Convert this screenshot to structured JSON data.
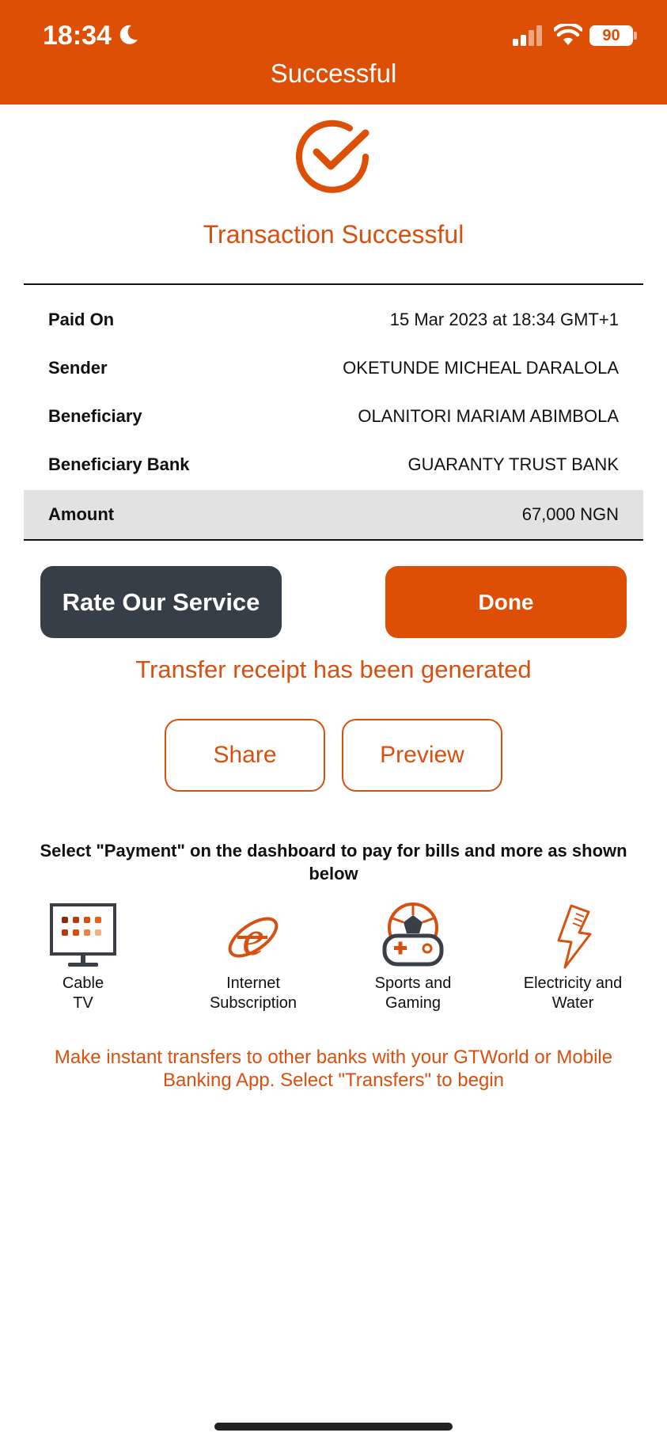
{
  "status_bar": {
    "time": "18:34",
    "battery": "90",
    "icons": [
      "moon-icon",
      "signal-icon",
      "wifi-icon",
      "battery-icon"
    ]
  },
  "header": {
    "title": "Successful"
  },
  "result": {
    "icon": "check-circle-icon",
    "title": "Transaction Successful"
  },
  "details": [
    {
      "label": "Paid On",
      "value": "15 Mar 2023 at 18:34 GMT+1"
    },
    {
      "label": "Sender",
      "value": "OKETUNDE MICHEAL DARALOLA"
    },
    {
      "label": "Beneficiary",
      "value": "OLANITORI MARIAM ABIMBOLA"
    },
    {
      "label": "Beneficiary Bank",
      "value": "GUARANTY TRUST BANK"
    },
    {
      "label": "Amount",
      "value": "67,000 NGN"
    }
  ],
  "actions": {
    "rate_label": "Rate Our Service",
    "done_label": "Done"
  },
  "receipt": {
    "message": "Transfer receipt has been generated",
    "share_label": "Share",
    "preview_label": "Preview"
  },
  "promo": {
    "title": "Select \"Payment\" on the dashboard to pay for bills and more as shown below",
    "services": [
      {
        "icon": "tv-icon",
        "label": "Cable\nTV"
      },
      {
        "icon": "internet-icon",
        "label": "Internet\nSubscription"
      },
      {
        "icon": "gamepad-ball-icon",
        "label": "Sports and\nGaming"
      },
      {
        "icon": "lightning-icon",
        "label": "Electricity and\nWater"
      }
    ]
  },
  "footer": {
    "message": "Make instant transfers to other banks with your GTWorld or Mobile Banking App. Select \"Transfers\" to begin"
  },
  "colors": {
    "brand": "#dd4f05",
    "accent_text": "#d8500f",
    "dark_button": "#363e47",
    "amount_row_bg": "#e2e2e2"
  }
}
